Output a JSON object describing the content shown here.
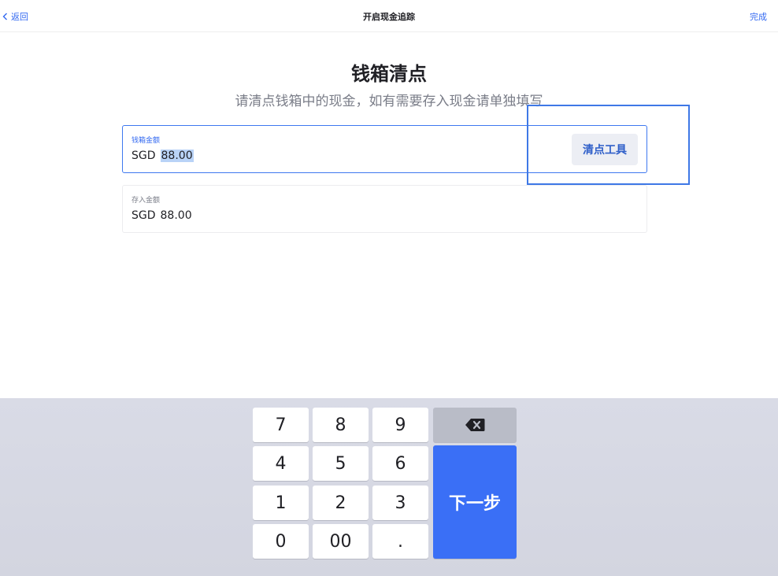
{
  "nav": {
    "back_label": "返回",
    "title": "开启现金追踪",
    "done_label": "完成"
  },
  "main": {
    "heading": "钱箱清点",
    "subheading": "请清点钱箱中的现金，如有需要存入现金请单独填写"
  },
  "drawer_field": {
    "label": "钱箱金额",
    "currency": "SGD",
    "amount": "88.00",
    "tool_button": "清点工具"
  },
  "deposit_field": {
    "label": "存入金额",
    "currency": "SGD",
    "amount": "88.00"
  },
  "keypad": {
    "keys": [
      "7",
      "8",
      "9",
      "4",
      "5",
      "6",
      "1",
      "2",
      "3",
      "0",
      "00",
      "."
    ],
    "delete_icon": "backspace-icon",
    "next_label": "下一步"
  },
  "colors": {
    "accent": "#3369f1",
    "next_button": "#3a6ff6",
    "keyboard_bg": "#d9dbe6"
  }
}
